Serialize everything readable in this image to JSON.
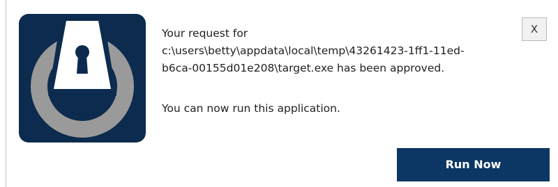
{
  "notification": {
    "message_lines": [
      "Your request for",
      "c:\\users\\betty\\appdata\\local\\temp\\43261423-1ff1-11ed-",
      "b6ca-00155d01e208\\target.exe has been approved."
    ],
    "message_secondary": "You can now run this application.",
    "close_label": "X",
    "run_button_label": "Run Now"
  },
  "icon": {
    "name": "padlock-keyhole-icon"
  },
  "colors": {
    "logo_background": "#0c2b4e",
    "logo_ring": "#9a9a9a",
    "logo_shield": "#ffffff",
    "button_background": "#0c3664",
    "button_text": "#ffffff"
  }
}
